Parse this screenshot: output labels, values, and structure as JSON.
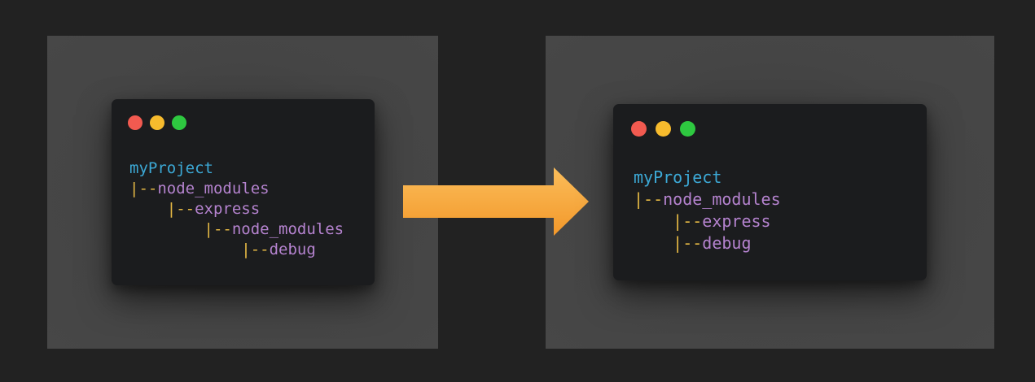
{
  "colors": {
    "background": "#222222",
    "panel": "#454545",
    "window": "#1b1c1e",
    "root_name": "#3ca9d6",
    "node_name": "#b583cf",
    "pipe": "#e5b844",
    "arrow_top": "#fbbd5a",
    "arrow_bottom": "#f3982a",
    "dot_close": "#f25a50",
    "dot_minimize": "#f7bb2d",
    "dot_maximize": "#2ec840"
  },
  "left": {
    "tree": [
      {
        "indent": "",
        "pipe": "",
        "name": "myProject",
        "kind": "root"
      },
      {
        "indent": "",
        "pipe": "|--",
        "name": "node_modules",
        "kind": "node"
      },
      {
        "indent": "    ",
        "pipe": "|--",
        "name": "express",
        "kind": "node"
      },
      {
        "indent": "        ",
        "pipe": "|--",
        "name": "node_modules",
        "kind": "node"
      },
      {
        "indent": "            ",
        "pipe": "|--",
        "name": "debug",
        "kind": "node"
      }
    ]
  },
  "right": {
    "tree": [
      {
        "indent": "",
        "pipe": "",
        "name": "myProject",
        "kind": "root"
      },
      {
        "indent": "",
        "pipe": "|--",
        "name": "node_modules",
        "kind": "node"
      },
      {
        "indent": "    ",
        "pipe": "|--",
        "name": "express",
        "kind": "node"
      },
      {
        "indent": "    ",
        "pipe": "|--",
        "name": "debug",
        "kind": "node"
      }
    ]
  },
  "arrow_icon": "right-arrow-icon"
}
